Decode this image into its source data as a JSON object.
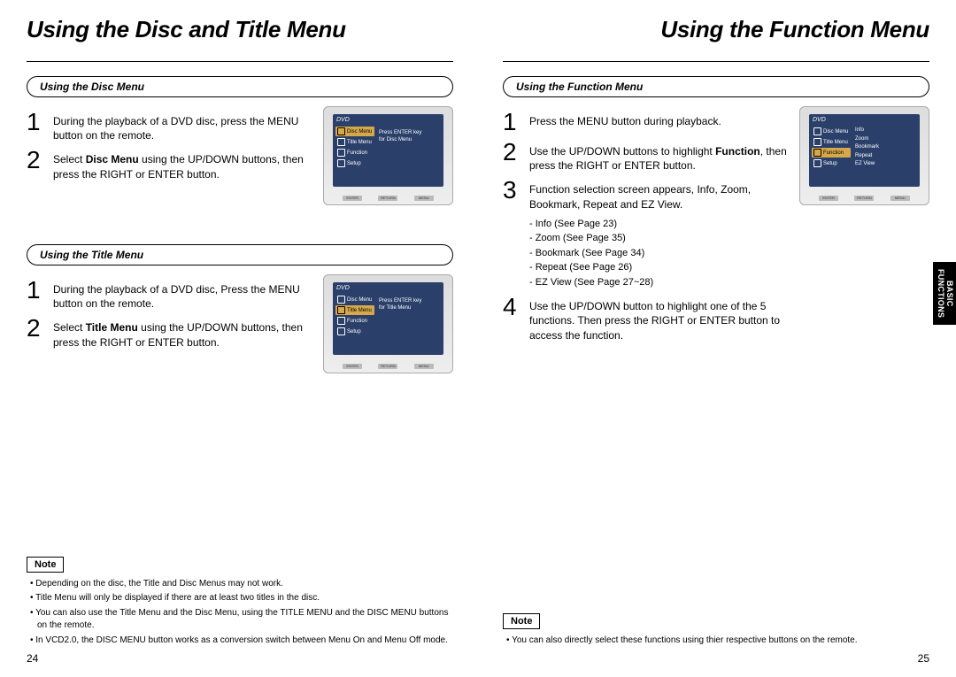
{
  "left": {
    "title": "Using the Disc and Title Menu",
    "sectionA": {
      "heading": "Using the Disc Menu",
      "steps": [
        "During the playback of a DVD disc, press the MENU button on the remote.",
        "Select <b>Disc Menu</b> using the UP/DOWN buttons, then press the RIGHT or ENTER button."
      ],
      "tv": {
        "dvd": "DVD",
        "menu": [
          "Disc Menu",
          "Title Menu",
          "Function",
          "Setup"
        ],
        "selected": 0,
        "prompt1": "Press ENTER key",
        "prompt2": "for Disc Menu",
        "buttons": [
          "ENTER",
          "RETURN",
          "MENU"
        ]
      }
    },
    "sectionB": {
      "heading": "Using the Title Menu",
      "steps": [
        "During the playback of a DVD disc, Press the MENU button on the remote.",
        "Select <b>Title Menu</b> using the UP/DOWN buttons, then press the RIGHT or ENTER button."
      ],
      "tv": {
        "dvd": "DVD",
        "menu": [
          "Disc Menu",
          "Title Menu",
          "Function",
          "Setup"
        ],
        "selected": 1,
        "prompt1": "Press ENTER key",
        "prompt2": "for Title Menu",
        "buttons": [
          "ENTER",
          "RETURN",
          "MENU"
        ]
      }
    },
    "noteLabel": "Note",
    "notes": [
      "Depending on the disc, the Title and Disc Menus may not work.",
      "Title Menu will only be displayed if there are at least two titles in the disc.",
      "You can also use the Title Menu and the Disc Menu, using the TITLE MENU and the DISC MENU buttons on the remote.",
      "In VCD2.0, the DISC MENU button works as a conversion switch between Menu On and Menu Off mode."
    ],
    "page": "24"
  },
  "right": {
    "title": "Using the Function Menu",
    "section": {
      "heading": "Using the Function Menu",
      "steps": [
        "Press the MENU button during playback.",
        "Use the UP/DOWN buttons to highlight <b>Function</b>, then press the RIGHT or ENTER button.",
        "Function selection screen appears, Info, Zoom, Bookmark, Repeat and EZ View.",
        "Use the UP/DOWN button to highlight one of the 5 functions. Then press the RIGHT or ENTER button to access the function."
      ],
      "sublist": [
        "Info (See Page 23)",
        "Zoom (See Page 35)",
        "Bookmark (See Page 34)",
        "Repeat (See Page 26)",
        "EZ View (See Page 27~28)"
      ],
      "tv": {
        "dvd": "DVD",
        "menu": [
          "Disc Menu",
          "Title Menu",
          "Function",
          "Setup"
        ],
        "selected": 2,
        "functions": [
          "Info",
          "Zoom",
          "Bookmark",
          "Repeat",
          "EZ View"
        ],
        "buttons": [
          "ENTER",
          "RETURN",
          "MENU"
        ]
      }
    },
    "noteLabel": "Note",
    "notes": [
      "You can also directly select these functions using thier respective buttons on the remote."
    ],
    "page": "25",
    "sideTab": "BASIC\nFUNCTIONS"
  }
}
